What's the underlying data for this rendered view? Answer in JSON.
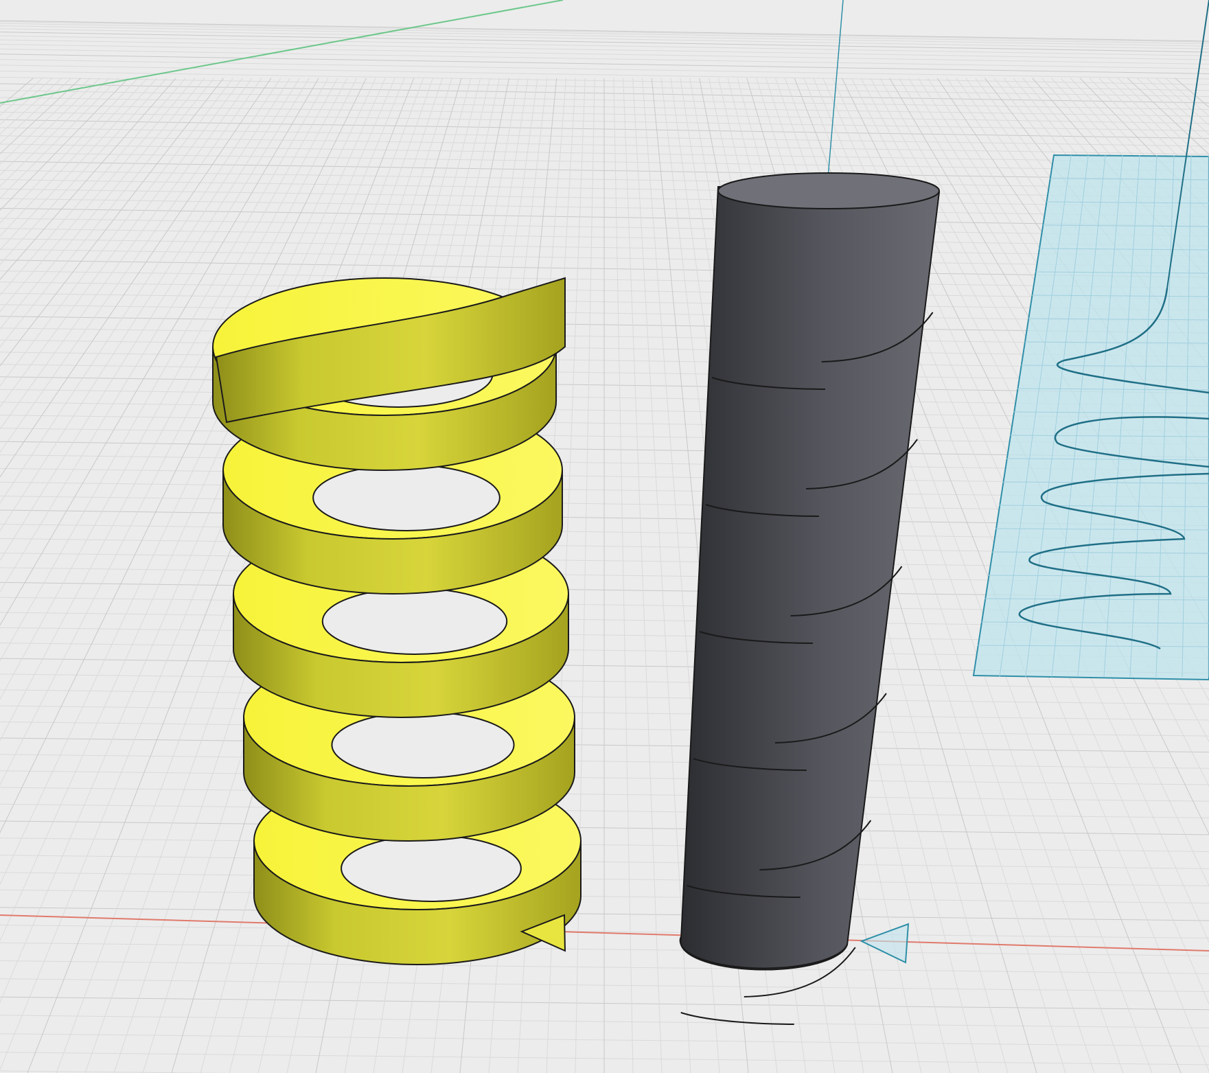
{
  "viewport": {
    "background": "#ececec",
    "grid": true,
    "grid_minor_color": "#dadada",
    "grid_major_color": "#c8c8c8"
  },
  "axes": {
    "x_axis_color": "#e07a6c",
    "y_axis_color": "#6cc78a",
    "z_axis_color": "#2f8fa8"
  },
  "objects": {
    "helix_ribbon": {
      "color": "#f2ef3c",
      "edge": "#1a1a1a",
      "turns": 5
    },
    "cylinder": {
      "color": "#4a4b52",
      "top": "#6f7078",
      "edge": "#1a1a1a",
      "seam_turns": 6
    },
    "sketch_plane": {
      "fill": "#bfe4ee",
      "stroke": "#2f8fa8",
      "curve": "#1f6f86"
    }
  },
  "icons": {
    "gizmo": "triangle-marker-icon"
  }
}
